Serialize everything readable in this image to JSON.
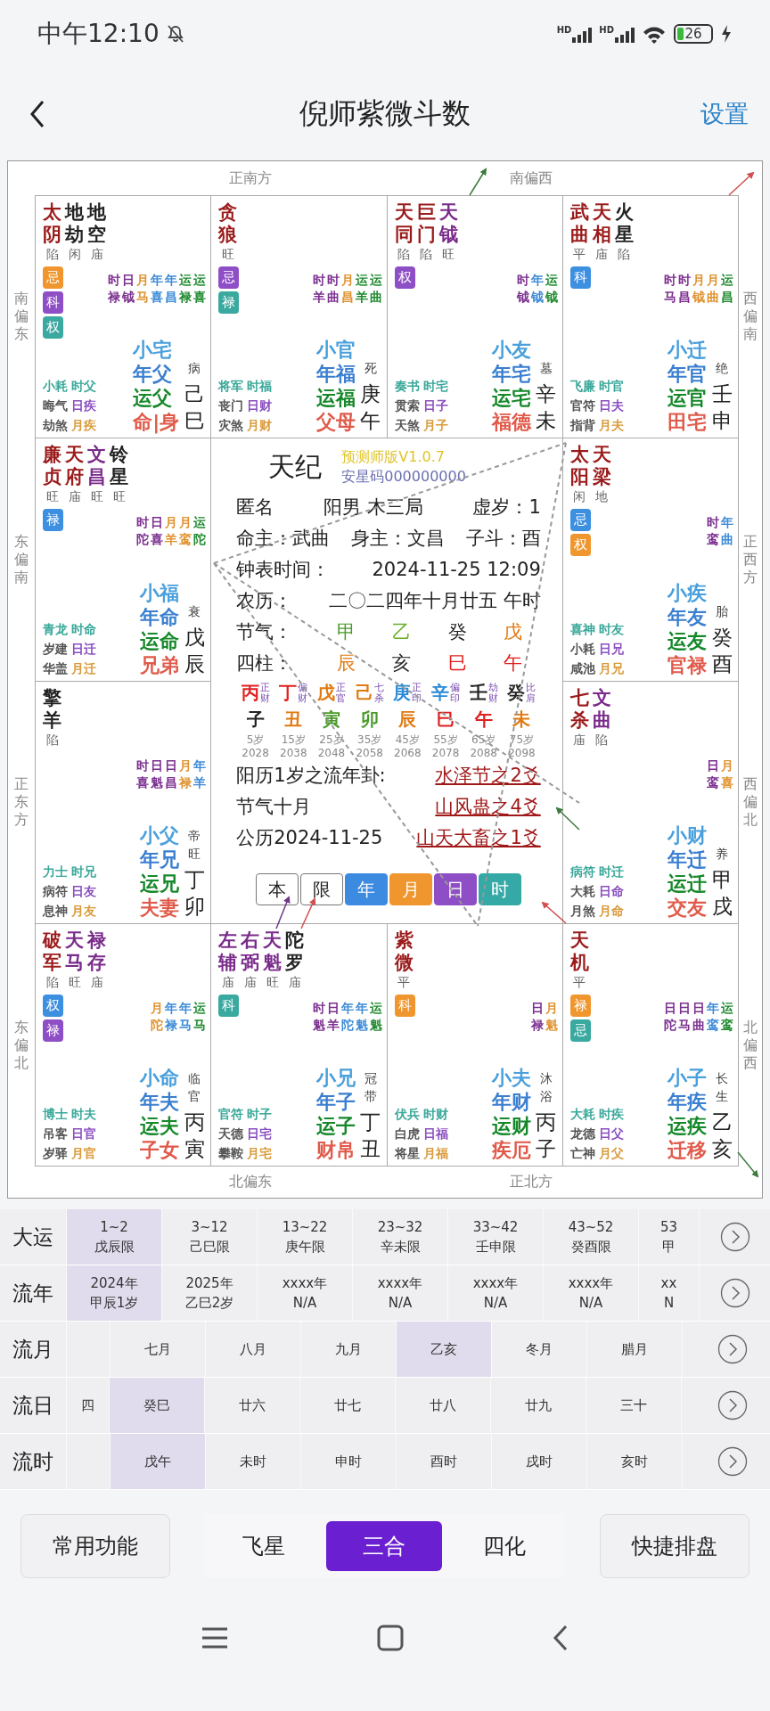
{
  "status_bar": {
    "time": "中午12:10",
    "network_labels": [
      "HD",
      "HD"
    ],
    "battery": "26"
  },
  "header": {
    "title": "倪师紫微斗数",
    "action": "设置"
  },
  "chart": {
    "directions": {
      "top": [
        "正南方",
        "南偏西"
      ],
      "bottom": [
        "北偏东",
        "正北方"
      ],
      "left": [
        "南偏东",
        "东偏南",
        "正东方",
        "东偏北"
      ],
      "right": [
        "西偏南",
        "正西方",
        "西偏北",
        "北偏西"
      ]
    },
    "palaces": [
      {
        "stars": [
          {
            "name": "太阴",
            "brightness": "陷",
            "kind": "major"
          },
          {
            "name": "地劫",
            "brightness": "闲",
            "kind": "malefic"
          },
          {
            "name": "地空",
            "brightness": "庙",
            "kind": "malefic"
          }
        ],
        "sihua": [
          {
            "text": "忌",
            "color": "#f0962e"
          },
          {
            "text": "科",
            "color": "#8e4ec6"
          },
          {
            "text": "权",
            "color": "#3aa9a0"
          }
        ],
        "flow_stars": [
          {
            "text": "时禄",
            "color": "#7b2f8f"
          },
          {
            "text": "日钺",
            "color": "#7b2f8f"
          },
          {
            "text": "月马",
            "color": "#e0922e"
          },
          {
            "text": "年喜",
            "color": "#3d8bd6"
          },
          {
            "text": "年昌",
            "color": "#3d8bd6"
          },
          {
            "text": "运禄",
            "color": "#1e8a2e"
          },
          {
            "text": "运喜",
            "color": "#1e8a2e"
          }
        ],
        "gods": [
          {
            "text": "小耗",
            "color": "#3aa89a"
          },
          {
            "text": "时父",
            "color": "#3aa89a"
          },
          {
            "text": "晦气",
            "color": "#555555"
          },
          {
            "text": "日疾",
            "color": "#8a4fc0"
          },
          {
            "text": "劫煞",
            "color": "#555555"
          },
          {
            "text": "月疾",
            "color": "#d99a3a"
          }
        ],
        "names": [
          {
            "text": "小宅",
            "color": "#4aa0dc"
          },
          {
            "text": "年父",
            "color": "#3a7fd0"
          },
          {
            "text": "运父",
            "color": "#16882a"
          },
          {
            "text": "命|身",
            "color": "#e05a4a"
          }
        ],
        "stage": "病",
        "stem": "己",
        "branch": "巳"
      },
      {
        "stars": [
          {
            "name": "贪狼",
            "brightness": "旺",
            "kind": "major"
          }
        ],
        "sihua": [
          {
            "text": "忌",
            "color": "#8e4ec6"
          },
          {
            "text": "禄",
            "color": "#3aa9a0"
          }
        ],
        "flow_stars": [
          {
            "text": "时羊",
            "color": "#7b2f8f"
          },
          {
            "text": "时曲",
            "color": "#7b2f8f"
          },
          {
            "text": "月昌",
            "color": "#e0922e"
          },
          {
            "text": "运羊",
            "color": "#1e8a2e"
          },
          {
            "text": "运曲",
            "color": "#1e8a2e"
          }
        ],
        "gods": [
          {
            "text": "将军",
            "color": "#3aa89a"
          },
          {
            "text": "时福",
            "color": "#3aa89a"
          },
          {
            "text": "丧门",
            "color": "#555555"
          },
          {
            "text": "日财",
            "color": "#8a4fc0"
          },
          {
            "text": "灾煞",
            "color": "#555555"
          },
          {
            "text": "月财",
            "color": "#d99a3a"
          }
        ],
        "names": [
          {
            "text": "小官",
            "color": "#4aa0dc"
          },
          {
            "text": "年福",
            "color": "#3a7fd0"
          },
          {
            "text": "运福",
            "color": "#16882a"
          },
          {
            "text": "父母",
            "color": "#e05a4a"
          }
        ],
        "stage": "死",
        "stem": "庚",
        "branch": "午"
      },
      {
        "stars": [
          {
            "name": "天同",
            "brightness": "陷",
            "kind": "major"
          },
          {
            "name": "巨门",
            "brightness": "陷",
            "kind": "major"
          },
          {
            "name": "天钺",
            "brightness": "旺",
            "kind": "lucky"
          }
        ],
        "sihua": [
          {
            "text": "权",
            "color": "#8e4ec6"
          }
        ],
        "flow_stars": [
          {
            "text": "时钺",
            "color": "#7b2f8f"
          },
          {
            "text": "年钺",
            "color": "#3d8bd6"
          },
          {
            "text": "运钺",
            "color": "#1e8a2e"
          }
        ],
        "gods": [
          {
            "text": "奏书",
            "color": "#3aa89a"
          },
          {
            "text": "时宅",
            "color": "#3aa89a"
          },
          {
            "text": "贯索",
            "color": "#555555"
          },
          {
            "text": "日子",
            "color": "#8a4fc0"
          },
          {
            "text": "天煞",
            "color": "#555555"
          },
          {
            "text": "月子",
            "color": "#d99a3a"
          }
        ],
        "names": [
          {
            "text": "小友",
            "color": "#4aa0dc"
          },
          {
            "text": "年宅",
            "color": "#3a7fd0"
          },
          {
            "text": "运宅",
            "color": "#16882a"
          },
          {
            "text": "福德",
            "color": "#e05a4a"
          }
        ],
        "stage": "墓",
        "stem": "辛",
        "branch": "未"
      },
      {
        "stars": [
          {
            "name": "武曲",
            "brightness": "平",
            "kind": "major"
          },
          {
            "name": "天相",
            "brightness": "庙",
            "kind": "major"
          },
          {
            "name": "火星",
            "brightness": "陷",
            "kind": "malefic"
          }
        ],
        "sihua": [
          {
            "text": "科",
            "color": "#3d8fe0"
          }
        ],
        "flow_stars": [
          {
            "text": "时马",
            "color": "#7b2f8f"
          },
          {
            "text": "时昌",
            "color": "#7b2f8f"
          },
          {
            "text": "月钺",
            "color": "#e0922e"
          },
          {
            "text": "月曲",
            "color": "#e0922e"
          },
          {
            "text": "运昌",
            "color": "#1e8a2e"
          }
        ],
        "gods": [
          {
            "text": "飞廉",
            "color": "#3aa89a"
          },
          {
            "text": "时官",
            "color": "#3aa89a"
          },
          {
            "text": "官符",
            "color": "#555555"
          },
          {
            "text": "日夫",
            "color": "#8a4fc0"
          },
          {
            "text": "指背",
            "color": "#555555"
          },
          {
            "text": "月夫",
            "color": "#d99a3a"
          }
        ],
        "names": [
          {
            "text": "小迁",
            "color": "#4aa0dc"
          },
          {
            "text": "年官",
            "color": "#3a7fd0"
          },
          {
            "text": "运官",
            "color": "#16882a"
          },
          {
            "text": "田宅",
            "color": "#e05a4a"
          }
        ],
        "stage": "绝",
        "stem": "壬",
        "branch": "申"
      },
      {
        "stars": [
          {
            "name": "廉贞",
            "brightness": "旺",
            "kind": "major"
          },
          {
            "name": "天府",
            "brightness": "庙",
            "kind": "major"
          },
          {
            "name": "文昌",
            "brightness": "旺",
            "kind": "lucky"
          },
          {
            "name": "铃星",
            "brightness": "旺",
            "kind": "malefic"
          }
        ],
        "sihua": [
          {
            "text": "禄",
            "color": "#3d8fe0"
          }
        ],
        "flow_stars": [
          {
            "text": "时陀",
            "color": "#7b2f8f"
          },
          {
            "text": "日喜",
            "color": "#7b2f8f"
          },
          {
            "text": "月羊",
            "color": "#e0922e"
          },
          {
            "text": "月鸾",
            "color": "#e0922e"
          },
          {
            "text": "运陀",
            "color": "#1e8a2e"
          }
        ],
        "gods": [
          {
            "text": "青龙",
            "color": "#3aa89a"
          },
          {
            "text": "时命",
            "color": "#3aa89a"
          },
          {
            "text": "岁建",
            "color": "#555555"
          },
          {
            "text": "日迁",
            "color": "#8a4fc0"
          },
          {
            "text": "华盖",
            "color": "#555555"
          },
          {
            "text": "月迁",
            "color": "#d99a3a"
          }
        ],
        "names": [
          {
            "text": "小福",
            "color": "#4aa0dc"
          },
          {
            "text": "年命",
            "color": "#3a7fd0"
          },
          {
            "text": "运命",
            "color": "#16882a"
          },
          {
            "text": "兄弟",
            "color": "#e05a4a"
          }
        ],
        "stage": "衰",
        "stem": "戊",
        "branch": "辰"
      },
      {
        "stars": [
          {
            "name": "太阳",
            "brightness": "闲",
            "kind": "major"
          },
          {
            "name": "天梁",
            "brightness": "地",
            "kind": "major"
          }
        ],
        "sihua": [
          {
            "text": "忌",
            "color": "#3d8fe0"
          },
          {
            "text": "权",
            "color": "#f0962e"
          }
        ],
        "flow_stars": [
          {
            "text": "时鸾",
            "color": "#7b2f8f"
          },
          {
            "text": "年曲",
            "color": "#3d8bd6"
          }
        ],
        "gods": [
          {
            "text": "喜神",
            "color": "#3aa89a"
          },
          {
            "text": "时友",
            "color": "#3aa89a"
          },
          {
            "text": "小耗",
            "color": "#555555"
          },
          {
            "text": "日兄",
            "color": "#8a4fc0"
          },
          {
            "text": "咸池",
            "color": "#555555"
          },
          {
            "text": "月兄",
            "color": "#d99a3a"
          }
        ],
        "names": [
          {
            "text": "小疾",
            "color": "#4aa0dc"
          },
          {
            "text": "年友",
            "color": "#3a7fd0"
          },
          {
            "text": "运友",
            "color": "#16882a"
          },
          {
            "text": "官禄",
            "color": "#e05a4a"
          }
        ],
        "stage": "胎",
        "stem": "癸",
        "branch": "酉"
      },
      {
        "stars": [
          {
            "name": "擎羊",
            "brightness": "陷",
            "kind": "malefic"
          }
        ],
        "flow_stars": [
          {
            "text": "时喜",
            "color": "#7b2f8f"
          },
          {
            "text": "日魁",
            "color": "#7b2f8f"
          },
          {
            "text": "日昌",
            "color": "#7b2f8f"
          },
          {
            "text": "月禄",
            "color": "#e0922e"
          },
          {
            "text": "年羊",
            "color": "#3d8bd6"
          }
        ],
        "gods": [
          {
            "text": "力士",
            "color": "#3aa89a"
          },
          {
            "text": "时兄",
            "color": "#3aa89a"
          },
          {
            "text": "病符",
            "color": "#555555"
          },
          {
            "text": "日友",
            "color": "#8a4fc0"
          },
          {
            "text": "息神",
            "color": "#555555"
          },
          {
            "text": "月友",
            "color": "#d99a3a"
          }
        ],
        "names": [
          {
            "text": "小父",
            "color": "#4aa0dc"
          },
          {
            "text": "年兄",
            "color": "#3a7fd0"
          },
          {
            "text": "运兄",
            "color": "#16882a"
          },
          {
            "text": "夫妻",
            "color": "#e05a4a"
          }
        ],
        "stage": "帝旺",
        "stem": "丁",
        "branch": "卯"
      },
      {
        "stars": [
          {
            "name": "七杀",
            "brightness": "庙",
            "kind": "major"
          },
          {
            "name": "文曲",
            "brightness": "陷",
            "kind": "lucky"
          }
        ],
        "flow_stars": [
          {
            "text": "日鸾",
            "color": "#7b2f8f"
          },
          {
            "text": "月喜",
            "color": "#e0922e"
          }
        ],
        "gods": [
          {
            "text": "病符",
            "color": "#3aa89a"
          },
          {
            "text": "时迁",
            "color": "#3aa89a"
          },
          {
            "text": "大耗",
            "color": "#555555"
          },
          {
            "text": "日命",
            "color": "#8a4fc0"
          },
          {
            "text": "月煞",
            "color": "#555555"
          },
          {
            "text": "月命",
            "color": "#d99a3a"
          }
        ],
        "names": [
          {
            "text": "小财",
            "color": "#4aa0dc"
          },
          {
            "text": "年迁",
            "color": "#3a7fd0"
          },
          {
            "text": "运迁",
            "color": "#16882a"
          },
          {
            "text": "交友",
            "color": "#e05a4a"
          }
        ],
        "stage": "养",
        "stem": "甲",
        "branch": "戌"
      },
      {
        "stars": [
          {
            "name": "破军",
            "brightness": "陷",
            "kind": "major"
          },
          {
            "name": "天马",
            "brightness": "旺",
            "kind": "lucky"
          },
          {
            "name": "禄存",
            "brightness": "庙",
            "kind": "lucky"
          }
        ],
        "sihua": [
          {
            "text": "权",
            "color": "#3d8fe0"
          },
          {
            "text": "禄",
            "color": "#8e4ec6"
          }
        ],
        "flow_stars": [
          {
            "text": "月陀",
            "color": "#e0922e"
          },
          {
            "text": "年禄",
            "color": "#3d8bd6"
          },
          {
            "text": "年马",
            "color": "#3d8bd6"
          },
          {
            "text": "运马",
            "color": "#1e8a2e"
          }
        ],
        "gods": [
          {
            "text": "博士",
            "color": "#3aa89a"
          },
          {
            "text": "时夫",
            "color": "#3aa89a"
          },
          {
            "text": "吊客",
            "color": "#555555"
          },
          {
            "text": "日官",
            "color": "#8a4fc0"
          },
          {
            "text": "岁驿",
            "color": "#555555"
          },
          {
            "text": "月官",
            "color": "#d99a3a"
          }
        ],
        "names": [
          {
            "text": "小命",
            "color": "#4aa0dc"
          },
          {
            "text": "年夫",
            "color": "#3a7fd0"
          },
          {
            "text": "运夫",
            "color": "#16882a"
          },
          {
            "text": "子女",
            "color": "#e05a4a"
          }
        ],
        "stage": "临官",
        "stem": "丙",
        "branch": "寅"
      },
      {
        "stars": [
          {
            "name": "左辅",
            "brightness": "庙",
            "kind": "lucky"
          },
          {
            "name": "右弼",
            "brightness": "庙",
            "kind": "lucky"
          },
          {
            "name": "天魁",
            "brightness": "旺",
            "kind": "lucky"
          },
          {
            "name": "陀罗",
            "brightness": "庙",
            "kind": "malefic"
          }
        ],
        "sihua": [
          {
            "text": "科",
            "color": "#3aa9a0"
          }
        ],
        "flow_stars": [
          {
            "text": "时魁",
            "color": "#7b2f8f"
          },
          {
            "text": "日羊",
            "color": "#7b2f8f"
          },
          {
            "text": "年陀",
            "color": "#3d8bd6"
          },
          {
            "text": "年魁",
            "color": "#3d8bd6"
          },
          {
            "text": "运魁",
            "color": "#1e8a2e"
          }
        ],
        "gods": [
          {
            "text": "官符",
            "color": "#3aa89a"
          },
          {
            "text": "时子",
            "color": "#3aa89a"
          },
          {
            "text": "天德",
            "color": "#555555"
          },
          {
            "text": "日宅",
            "color": "#8a4fc0"
          },
          {
            "text": "攀鞍",
            "color": "#555555"
          },
          {
            "text": "月宅",
            "color": "#d99a3a"
          }
        ],
        "names": [
          {
            "text": "小兄",
            "color": "#4aa0dc"
          },
          {
            "text": "年子",
            "color": "#3a7fd0"
          },
          {
            "text": "运子",
            "color": "#16882a"
          },
          {
            "text": "财帛",
            "color": "#e05a4a"
          }
        ],
        "stage": "冠带",
        "stem": "丁",
        "branch": "丑"
      },
      {
        "stars": [
          {
            "name": "紫微",
            "brightness": "平",
            "kind": "major"
          }
        ],
        "sihua": [
          {
            "text": "科",
            "color": "#f0962e"
          }
        ],
        "flow_stars": [
          {
            "text": "日禄",
            "color": "#7b2f8f"
          },
          {
            "text": "月魁",
            "color": "#e0922e"
          }
        ],
        "gods": [
          {
            "text": "伏兵",
            "color": "#3aa89a"
          },
          {
            "text": "时财",
            "color": "#3aa89a"
          },
          {
            "text": "白虎",
            "color": "#555555"
          },
          {
            "text": "日福",
            "color": "#8a4fc0"
          },
          {
            "text": "将星",
            "color": "#555555"
          },
          {
            "text": "月福",
            "color": "#d99a3a"
          }
        ],
        "names": [
          {
            "text": "小夫",
            "color": "#4aa0dc"
          },
          {
            "text": "年财",
            "color": "#3a7fd0"
          },
          {
            "text": "运财",
            "color": "#16882a"
          },
          {
            "text": "疾厄",
            "color": "#e05a4a"
          }
        ],
        "stage": "沐浴",
        "stem": "丙",
        "branch": "子"
      },
      {
        "stars": [
          {
            "name": "天机",
            "brightness": "平",
            "kind": "major"
          }
        ],
        "sihua": [
          {
            "text": "禄",
            "color": "#f0962e"
          },
          {
            "text": "忌",
            "color": "#3aa9a0"
          }
        ],
        "flow_stars": [
          {
            "text": "日陀",
            "color": "#7b2f8f"
          },
          {
            "text": "日马",
            "color": "#7b2f8f"
          },
          {
            "text": "日曲",
            "color": "#7b2f8f"
          },
          {
            "text": "年鸾",
            "color": "#3d8bd6"
          },
          {
            "text": "运鸾",
            "color": "#1e8a2e"
          }
        ],
        "gods": [
          {
            "text": "大耗",
            "color": "#3aa89a"
          },
          {
            "text": "时疾",
            "color": "#3aa89a"
          },
          {
            "text": "龙德",
            "color": "#555555"
          },
          {
            "text": "日父",
            "color": "#8a4fc0"
          },
          {
            "text": "亡神",
            "color": "#555555"
          },
          {
            "text": "月父",
            "color": "#d99a3a"
          }
        ],
        "names": [
          {
            "text": "小子",
            "color": "#4aa0dc"
          },
          {
            "text": "年疾",
            "color": "#3a7fd0"
          },
          {
            "text": "运疾",
            "color": "#16882a"
          },
          {
            "text": "迁移",
            "color": "#e05a4a"
          }
        ],
        "stage": "长生",
        "stem": "乙",
        "branch": "亥"
      }
    ],
    "center": {
      "title": "天纪",
      "edition": "预测师版V1.0.7",
      "code": "安星码000000000",
      "info_rows": [
        [
          "匿名",
          "阳男 木三局",
          "虚岁：1"
        ],
        [
          "命主：武曲",
          "身主：文昌",
          "子斗：酉"
        ],
        [
          "钟表时间：",
          "2024-11-25 12:09"
        ],
        [
          "农历：",
          "二〇二四年十月廿五 午时"
        ]
      ],
      "jieqi": {
        "label": "节气：",
        "chars": [
          {
            "text": "甲",
            "color": "#4a9a2a"
          },
          {
            "text": "乙",
            "color": "#6ab02a"
          },
          {
            "text": "癸",
            "color": "#222222"
          },
          {
            "text": "戊",
            "color": "#e07a10"
          }
        ]
      },
      "pillars": {
        "label": "四柱：",
        "chars": [
          {
            "text": "辰",
            "color": "#e07a10"
          },
          {
            "text": "亥",
            "color": "#222222"
          },
          {
            "text": "巳",
            "color": "#e02020"
          },
          {
            "text": "午",
            "color": "#e02020"
          }
        ]
      },
      "decades": [
        {
          "stem": {
            "text": "丙",
            "color": "#e02020"
          },
          "ten_god": "正财",
          "branch": {
            "text": "子",
            "color": "#222222"
          },
          "age": "5岁",
          "year": "2028"
        },
        {
          "stem": {
            "text": "丁",
            "color": "#e02020"
          },
          "ten_god": "偏财",
          "branch": {
            "text": "丑",
            "color": "#e07a10"
          },
          "age": "15岁",
          "year": "2038"
        },
        {
          "stem": {
            "text": "戊",
            "color": "#e07a10"
          },
          "ten_god": "正官",
          "branch": {
            "text": "寅",
            "color": "#4a9a2a"
          },
          "age": "25岁",
          "year": "2048"
        },
        {
          "stem": {
            "text": "己",
            "color": "#e07a10"
          },
          "ten_god": "七杀",
          "branch": {
            "text": "卯",
            "color": "#4a9a2a"
          },
          "age": "35岁",
          "year": "2058"
        },
        {
          "stem": {
            "text": "庚",
            "color": "#2a8ad6"
          },
          "ten_god": "正印",
          "branch": {
            "text": "辰",
            "color": "#e07a10"
          },
          "age": "45岁",
          "year": "2068"
        },
        {
          "stem": {
            "text": "辛",
            "color": "#2a8ad6"
          },
          "ten_god": "偏印",
          "branch": {
            "text": "巳",
            "color": "#e02020"
          },
          "age": "55岁",
          "year": "2078"
        },
        {
          "stem": {
            "text": "壬",
            "color": "#222222"
          },
          "ten_god": "劫财",
          "branch": {
            "text": "午",
            "color": "#e02020"
          },
          "age": "65岁",
          "year": "2088"
        },
        {
          "stem": {
            "text": "癸",
            "color": "#222222"
          },
          "ten_god": "比肩",
          "branch": {
            "text": "未",
            "color": "#e07a10"
          },
          "age": "75岁",
          "year": "2098"
        }
      ],
      "gua": [
        {
          "label": "阳历1岁之流年卦:",
          "link": "水泽节之2爻"
        },
        {
          "label": "节气十月",
          "link": "山风蛊之4爻"
        },
        {
          "label": "公历2024-11-25",
          "link": "山天大畜之1爻"
        }
      ],
      "buttons": [
        {
          "text": "本",
          "color": "#ffffff"
        },
        {
          "text": "限",
          "color": "#ffffff"
        },
        {
          "text": "年",
          "color": "#3d8be0"
        },
        {
          "text": "月",
          "color": "#f0962e"
        },
        {
          "text": "日",
          "color": "#8e4ec6"
        },
        {
          "text": "时",
          "color": "#35a9a6"
        }
      ]
    }
  },
  "timeline": [
    {
      "label": "大运",
      "cells": [
        {
          "lines": [
            "1~2",
            "戊辰限"
          ],
          "selected": true
        },
        {
          "lines": [
            "3~12",
            "己巳限"
          ],
          "selected": false
        },
        {
          "lines": [
            "13~22",
            "庚午限"
          ],
          "selected": false
        },
        {
          "lines": [
            "23~32",
            "辛未限"
          ],
          "selected": false
        },
        {
          "lines": [
            "33~42",
            "壬申限"
          ],
          "selected": false
        },
        {
          "lines": [
            "43~52",
            "癸酉限"
          ],
          "selected": false
        },
        {
          "lines": [
            "53",
            "甲"
          ],
          "selected": false,
          "partial": true
        }
      ]
    },
    {
      "label": "流年",
      "cells": [
        {
          "lines": [
            "2024年",
            "甲辰1岁"
          ],
          "selected": true
        },
        {
          "lines": [
            "2025年",
            "乙巳2岁"
          ],
          "selected": false
        },
        {
          "lines": [
            "xxxx年",
            "N/A"
          ],
          "selected": false
        },
        {
          "lines": [
            "xxxx年",
            "N/A"
          ],
          "selected": false
        },
        {
          "lines": [
            "xxxx年",
            "N/A"
          ],
          "selected": false
        },
        {
          "lines": [
            "xxxx年",
            "N/A"
          ],
          "selected": false
        },
        {
          "lines": [
            "xx",
            "N"
          ],
          "selected": false,
          "partial": true
        }
      ]
    },
    {
      "label": "流月",
      "clipped_start": true,
      "cells": [
        {
          "lines": [
            "七月"
          ],
          "selected": false
        },
        {
          "lines": [
            "八月"
          ],
          "selected": false
        },
        {
          "lines": [
            "九月"
          ],
          "selected": false
        },
        {
          "lines": [
            "乙亥"
          ],
          "selected": true
        },
        {
          "lines": [
            "冬月"
          ],
          "selected": false
        },
        {
          "lines": [
            "腊月"
          ],
          "selected": false
        }
      ]
    },
    {
      "label": "流日",
      "cells": [
        {
          "lines": [
            "四"
          ],
          "selected": false,
          "partial": true
        },
        {
          "lines": [
            "癸巳"
          ],
          "selected": true
        },
        {
          "lines": [
            "廿六"
          ],
          "selected": false
        },
        {
          "lines": [
            "廿七"
          ],
          "selected": false
        },
        {
          "lines": [
            "廿八"
          ],
          "selected": false
        },
        {
          "lines": [
            "廿九"
          ],
          "selected": false
        },
        {
          "lines": [
            "三十"
          ],
          "selected": false
        }
      ]
    },
    {
      "label": "流时",
      "clipped_start": true,
      "cells": [
        {
          "lines": [
            "戊午"
          ],
          "selected": true
        },
        {
          "lines": [
            "未时"
          ],
          "selected": false
        },
        {
          "lines": [
            "申时"
          ],
          "selected": false
        },
        {
          "lines": [
            "酉时"
          ],
          "selected": false
        },
        {
          "lines": [
            "戌时"
          ],
          "selected": false
        },
        {
          "lines": [
            "亥时"
          ],
          "selected": false
        }
      ]
    }
  ],
  "footer": {
    "left_button": "常用功能",
    "segments": [
      {
        "label": "飞星",
        "selected": false
      },
      {
        "label": "三合",
        "selected": true
      },
      {
        "label": "四化",
        "selected": false
      }
    ],
    "right_button": "快捷排盘"
  }
}
